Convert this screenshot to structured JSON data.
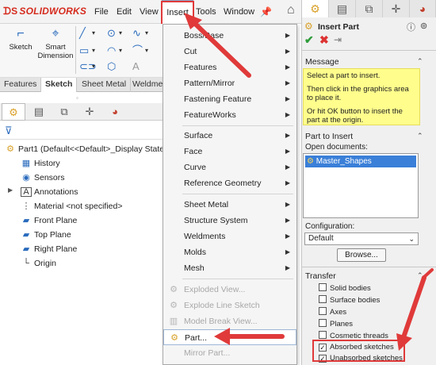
{
  "app": {
    "logo_ds": "ᗪS",
    "logo_text": "SOLIDWORKS"
  },
  "menubar": {
    "file": "File",
    "edit": "Edit",
    "view": "View",
    "insert": "Insert",
    "tools": "Tools",
    "window": "Window"
  },
  "command_manager": {
    "sketch": "Sketch",
    "smart_dimension_1": "Smart",
    "smart_dimension_2": "Dimension"
  },
  "tabs": [
    "Features",
    "Sketch",
    "Sheet Metal",
    "Weldme"
  ],
  "feature_tree": {
    "part": "Part1  (Default<<Default>_Display State",
    "items": [
      "History",
      "Sensors",
      "Annotations",
      "Material <not specified>",
      "Front Plane",
      "Top Plane",
      "Right Plane",
      "Origin"
    ]
  },
  "insert_menu": {
    "items": [
      {
        "label": "Boss/Base",
        "submenu": true
      },
      {
        "label": "Cut",
        "submenu": true
      },
      {
        "label": "Features",
        "submenu": true
      },
      {
        "label": "Pattern/Mirror",
        "submenu": true
      },
      {
        "label": "Fastening Feature",
        "submenu": true
      },
      {
        "label": "FeatureWorks",
        "submenu": true
      },
      {
        "label": "Surface",
        "submenu": true
      },
      {
        "label": "Face",
        "submenu": true
      },
      {
        "label": "Curve",
        "submenu": true
      },
      {
        "label": "Reference Geometry",
        "submenu": true
      },
      {
        "label": "Sheet Metal",
        "submenu": true
      },
      {
        "label": "Structure System",
        "submenu": true
      },
      {
        "label": "Weldments",
        "submenu": true
      },
      {
        "label": "Molds",
        "submenu": true
      },
      {
        "label": "Mesh",
        "submenu": true
      },
      {
        "label": "Exploded View...",
        "disabled": true
      },
      {
        "label": "Explode Line Sketch",
        "disabled": true
      },
      {
        "label": "Model Break View...",
        "disabled": true
      },
      {
        "label": "Part...",
        "highlight": true
      },
      {
        "label": "Mirror Part...",
        "disabled": true
      }
    ]
  },
  "property_manager": {
    "title": "Insert Part",
    "message_header": "Message",
    "message": [
      "Select a part to insert.",
      "Then click in the graphics area to place it.",
      "Or hit OK button to insert the part at the origin."
    ],
    "part_to_insert_header": "Part to Insert",
    "open_documents_label": "Open documents:",
    "open_documents": [
      "Master_Shapes"
    ],
    "configuration_label": "Configuration:",
    "configuration_value": "Default",
    "browse_label": "Browse...",
    "transfer_header": "Transfer",
    "transfer_options": [
      {
        "label": "Solid bodies",
        "checked": false
      },
      {
        "label": "Surface bodies",
        "checked": false
      },
      {
        "label": "Axes",
        "checked": false
      },
      {
        "label": "Planes",
        "checked": false
      },
      {
        "label": "Cosmetic threads",
        "checked": false
      },
      {
        "label": "Absorbed sketches",
        "checked": true
      },
      {
        "label": "Unabsorbed sketches",
        "checked": true
      }
    ]
  },
  "colors": {
    "accent_red": "#e03a3a",
    "selection_blue": "#3a7fd8",
    "message_yellow": "#fffe8c"
  }
}
